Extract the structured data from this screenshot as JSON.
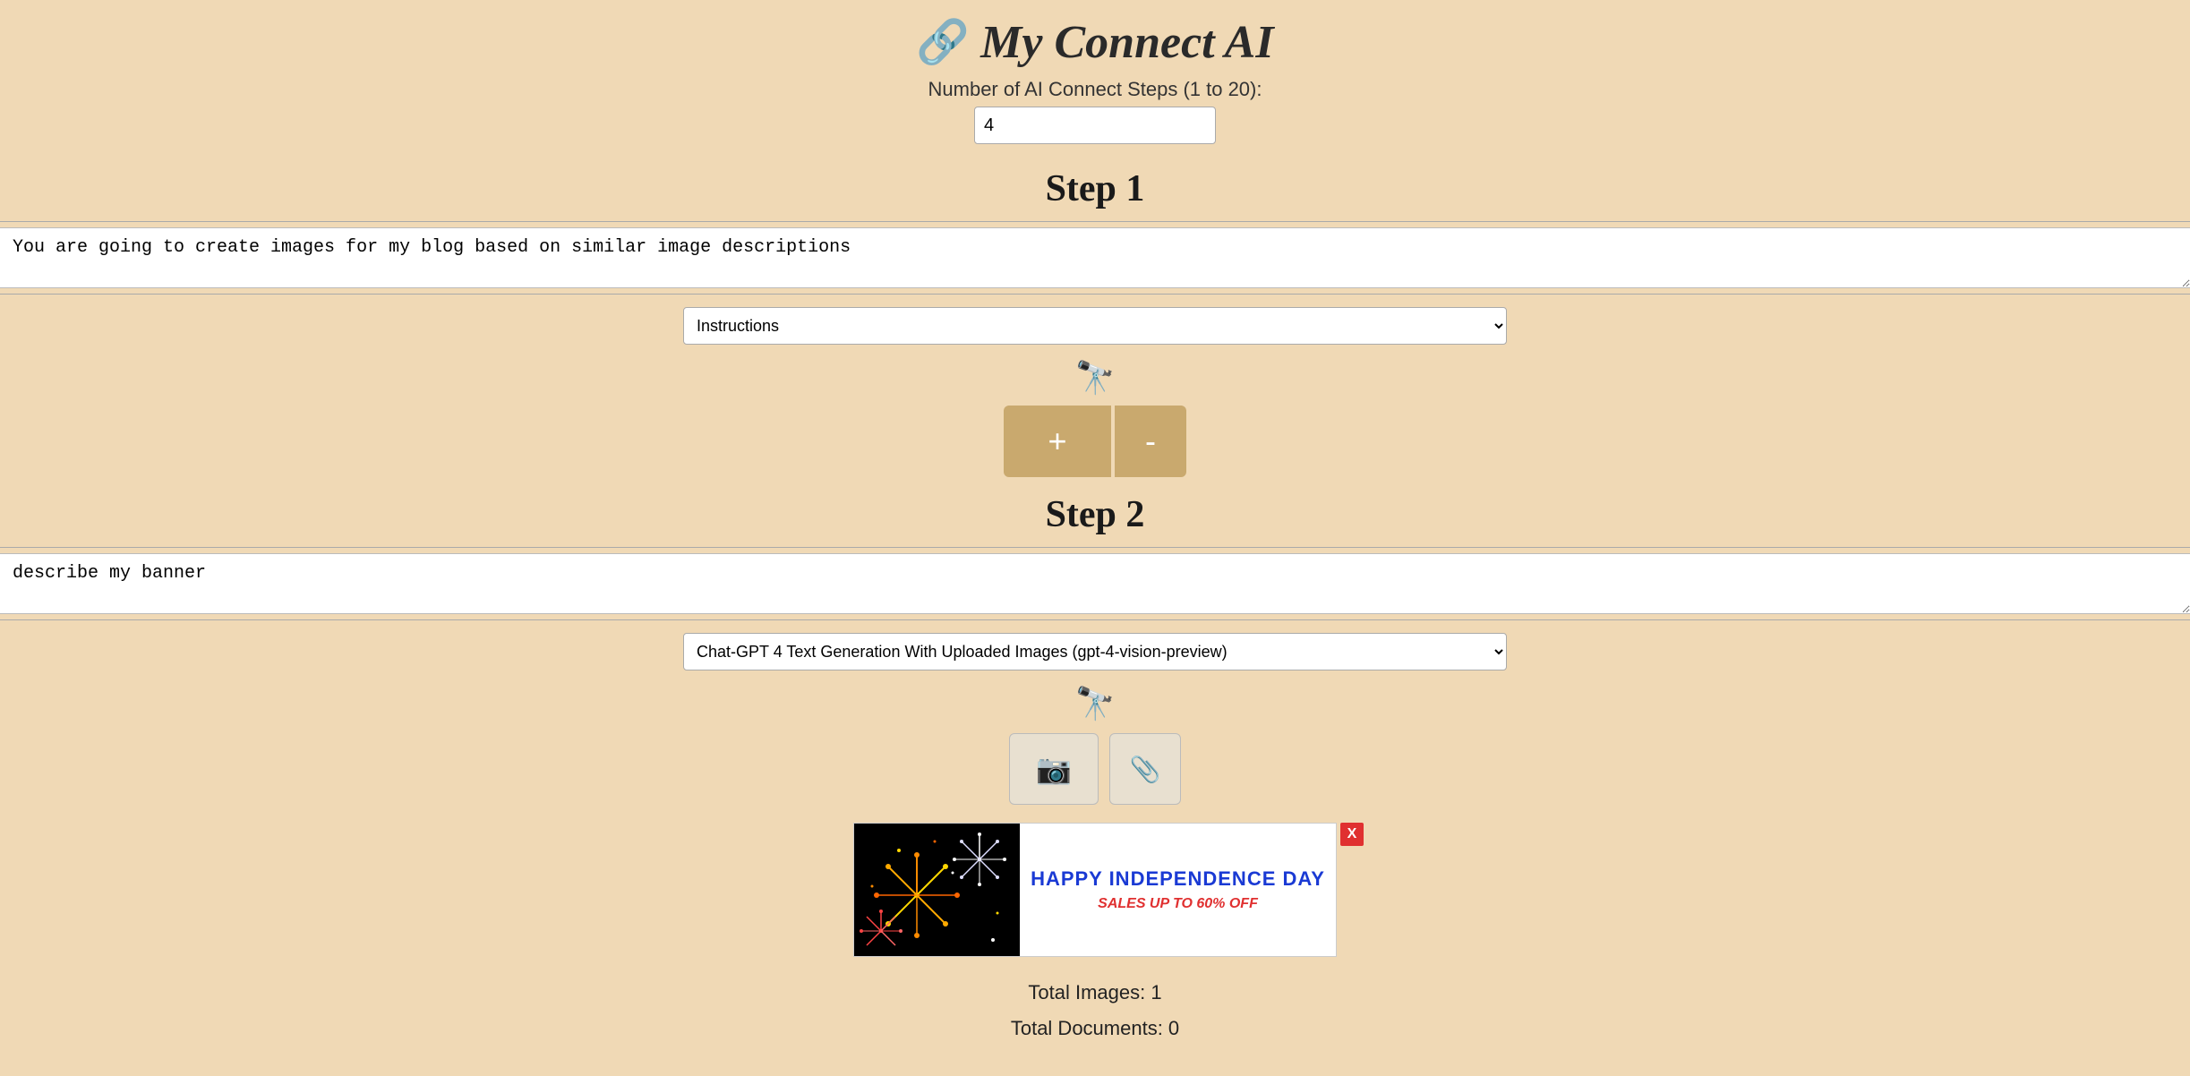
{
  "header": {
    "logo_icon": "🔗",
    "title": "My Connect AI"
  },
  "steps_control": {
    "label": "Number of AI Connect Steps (1 to 20):",
    "value": "4"
  },
  "step1": {
    "heading": "Step 1",
    "textarea_value": "You are going to create images for my blog based on similar image descriptions",
    "textarea_placeholder": "",
    "dropdown_label": "Instructions",
    "dropdown_options": [
      "Instructions"
    ]
  },
  "step2": {
    "heading": "Step 2",
    "textarea_value": "describe my banner",
    "textarea_placeholder": "",
    "dropdown_label": "Chat-GPT 4 Text Generation With Uploaded Images (gpt-4-vision-preview)",
    "dropdown_options": [
      "Chat-GPT 4 Text Generation With Uploaded Images (gpt-4-vision-preview)"
    ],
    "btn_plus_label": "+",
    "btn_minus_label": "-",
    "btn_camera_icon": "📷",
    "btn_paperclip_icon": "📎"
  },
  "banner": {
    "main_text": "HAPPY INDEPENDENCE DAY",
    "sub_text": "SALES UP TO 60% OFF",
    "close_label": "X"
  },
  "totals": {
    "images_label": "Total Images: 1",
    "documents_label": "Total Documents: 0"
  },
  "icons": {
    "binoculars": "🔭",
    "camera": "📷",
    "paperclip": "📎"
  }
}
